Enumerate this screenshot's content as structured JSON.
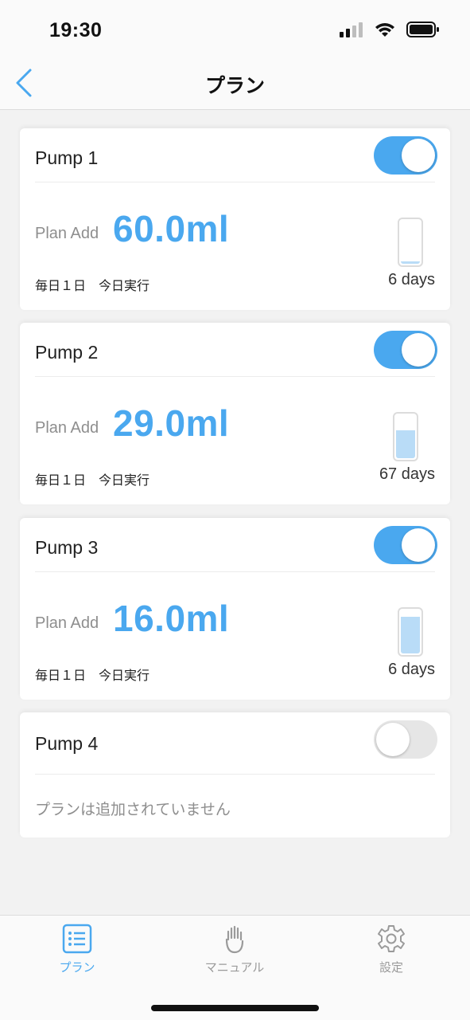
{
  "status_bar": {
    "time": "19:30"
  },
  "nav": {
    "title": "プラン"
  },
  "pumps": [
    {
      "name": "Pump 1",
      "enabled": true,
      "plan_label": "Plan Add",
      "amount": "60.0ml",
      "schedule": "毎日１日　今日実行",
      "days": "6 days",
      "level": 0.06
    },
    {
      "name": "Pump 2",
      "enabled": true,
      "plan_label": "Plan Add",
      "amount": "29.0ml",
      "schedule": "毎日１日　今日実行",
      "days": "67 days",
      "level": 0.6
    },
    {
      "name": "Pump 3",
      "enabled": true,
      "plan_label": "Plan Add",
      "amount": "16.0ml",
      "schedule": "毎日１日　今日実行",
      "days": "6 days",
      "level": 0.8
    },
    {
      "name": "Pump 4",
      "enabled": false,
      "empty_text": "プランは追加されていません"
    }
  ],
  "tabs": [
    {
      "label": "プラン",
      "icon": "list-icon",
      "active": true
    },
    {
      "label": "マニュアル",
      "icon": "hand-icon",
      "active": false
    },
    {
      "label": "設定",
      "icon": "gear-icon",
      "active": false
    }
  ],
  "colors": {
    "accent": "#4aa8ef",
    "toggle_off": "#e6e6e6",
    "fill": "#b9dcf7"
  }
}
